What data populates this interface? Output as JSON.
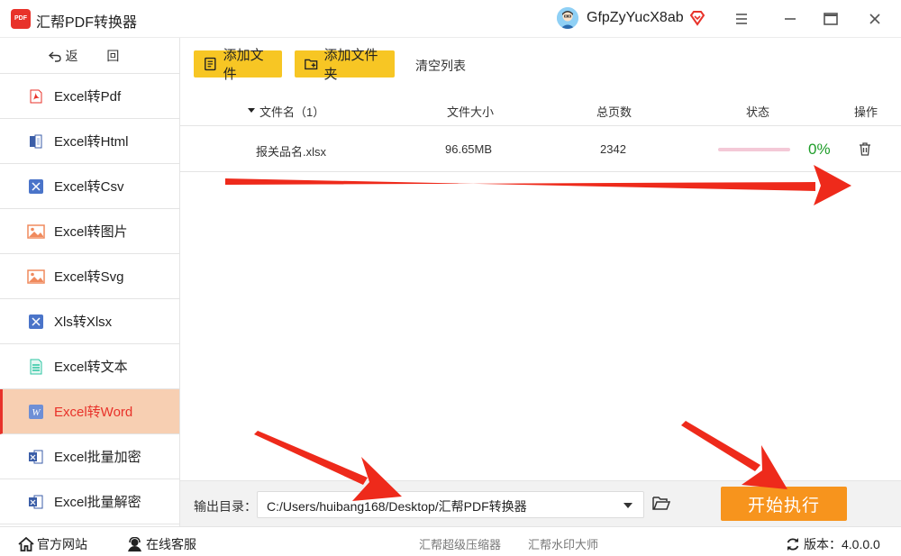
{
  "app": {
    "title": "汇帮PDF转换器",
    "logo_text": "PDF",
    "username": "GfpZyYucX8ab"
  },
  "sidebar": {
    "back_label": "返 回",
    "items": [
      {
        "label": "Excel转Pdf",
        "icon": "pdf-icon"
      },
      {
        "label": "Excel转Html",
        "icon": "html-icon"
      },
      {
        "label": "Excel转Csv",
        "icon": "csv-icon"
      },
      {
        "label": "Excel转图片",
        "icon": "image-icon"
      },
      {
        "label": "Excel转Svg",
        "icon": "svg-icon"
      },
      {
        "label": "Xls转Xlsx",
        "icon": "xlsx-icon"
      },
      {
        "label": "Excel转文本",
        "icon": "text-icon"
      },
      {
        "label": "Excel转Word",
        "icon": "word-icon",
        "active": true
      },
      {
        "label": "Excel批量加密",
        "icon": "encrypt-icon"
      },
      {
        "label": "Excel批量解密",
        "icon": "decrypt-icon"
      }
    ]
  },
  "toolbar": {
    "add_file": "添加文件",
    "add_folder": "添加文件夹",
    "clear_list": "清空列表"
  },
  "table": {
    "headers": {
      "filename": "文件名（1）",
      "size": "文件大小",
      "pages": "总页数",
      "status": "状态",
      "action": "操作"
    },
    "rows": [
      {
        "filename": "报关品名.xlsx",
        "size": "96.65MB",
        "pages": "2342",
        "progress": 0,
        "percent": "0%"
      }
    ]
  },
  "output": {
    "label": "输出目录：",
    "path": "C:/Users/huibang168/Desktop/汇帮PDF转换器",
    "start_label": "开始执行"
  },
  "footer": {
    "website": "官方网站",
    "service": "在线客服",
    "link1": "汇帮超级压缩器",
    "link2": "汇帮水印大师",
    "version": "版本：4.0.0.0"
  },
  "colors": {
    "accent_red": "#e8322a",
    "button_yellow": "#f7c624",
    "start_orange": "#f7941d",
    "active_bg": "#f7cfb2",
    "percent_green": "#1f9d2a"
  }
}
